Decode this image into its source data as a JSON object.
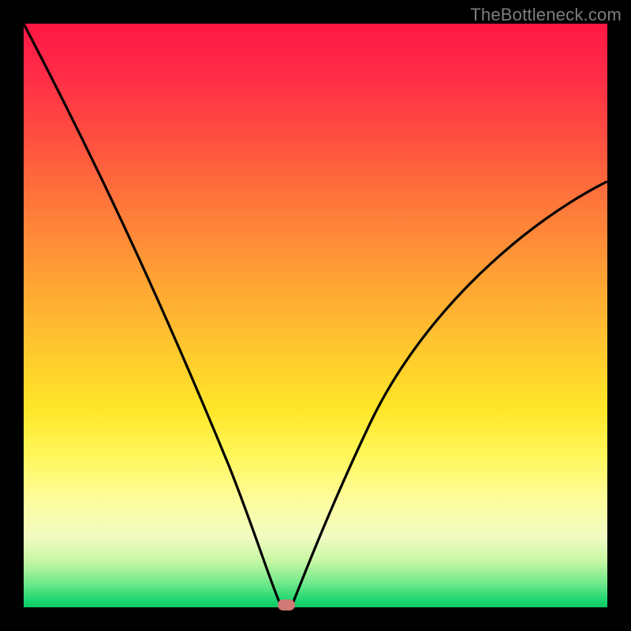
{
  "watermark": "TheBottleneck.com",
  "colors": {
    "frame_bg": "#000000",
    "curve_stroke": "#000000",
    "marker_fill": "#cf7a74",
    "gradient_top": "#ff1744",
    "gradient_bottom": "#0fc867",
    "watermark_text": "#7d7d7d"
  },
  "chart_data": {
    "type": "line",
    "title": "",
    "xlabel": "",
    "ylabel": "",
    "xlim": [
      0,
      100
    ],
    "ylim": [
      0,
      100
    ],
    "grid": false,
    "legend": false,
    "annotations": [
      {
        "type": "marker",
        "x": 45,
        "y": 0,
        "shape": "rounded-rect",
        "color": "#cf7a74"
      }
    ],
    "series": [
      {
        "name": "bottleneck-curve",
        "x": [
          0,
          5,
          10,
          15,
          20,
          25,
          30,
          35,
          40,
          43,
          45,
          47,
          50,
          55,
          60,
          65,
          70,
          75,
          80,
          85,
          90,
          95,
          100
        ],
        "y": [
          100,
          90,
          80,
          70,
          59,
          48,
          37,
          26,
          14,
          5,
          0,
          4,
          10,
          20,
          28,
          36,
          43,
          49,
          55,
          60,
          65,
          69,
          73
        ]
      }
    ]
  }
}
